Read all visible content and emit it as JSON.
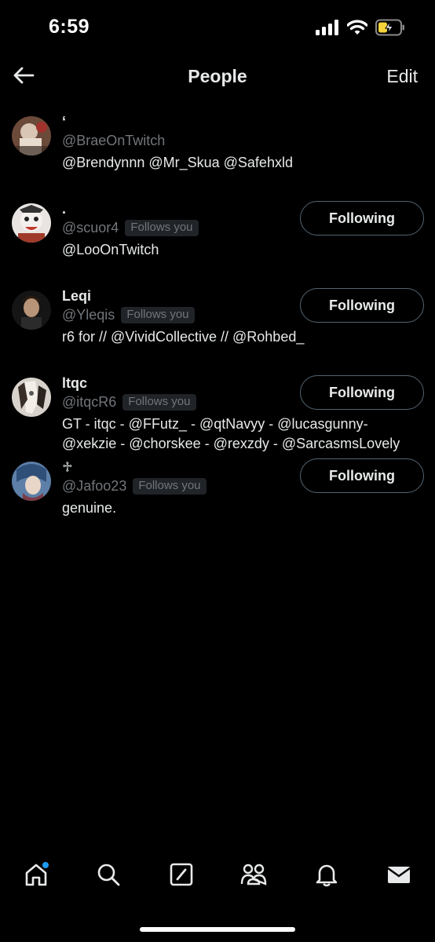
{
  "status_bar": {
    "time": "6:59",
    "icons": [
      "cellular-signal-icon",
      "wifi-icon",
      "battery-charging-icon"
    ],
    "battery_color": "#f5d33b"
  },
  "header": {
    "title": "People",
    "edit_label": "Edit",
    "back_icon": "back-arrow-icon"
  },
  "people": [
    {
      "display_name": "‘",
      "handle": "@BraeOnTwitch",
      "follows_you": false,
      "bio": [
        "@Brendynnn @Mr_Skua @Safehxld"
      ],
      "button_label": ""
    },
    {
      "display_name": ".",
      "handle": "@scuor4",
      "follows_you": true,
      "bio": [
        "@LooOnTwitch"
      ],
      "button_label": "Following"
    },
    {
      "display_name": "Leqi",
      "handle": "@Yleqis",
      "follows_you": true,
      "bio": [
        "r6 for // @VividCollective // @Rohbed_"
      ],
      "button_label": "Following"
    },
    {
      "display_name": "ltqc",
      "handle": "@itqcR6",
      "follows_you": true,
      "bio": [
        "GT - itqc - @FFutz_ - @qtNavyy - @lucasgunny-",
        "@xekzie - @chorskee - @rexzdy - @SarcasmsLovely"
      ],
      "button_label": "Following"
    },
    {
      "display_name": "♱",
      "handle": "@Jafoo23",
      "follows_you": true,
      "bio": [
        "genuine."
      ],
      "button_label": "Following"
    }
  ],
  "follows_you_label": "Follows you",
  "tab_bar": {
    "tabs": [
      "home-icon",
      "search-icon",
      "compose-icon",
      "communities-icon",
      "notifications-icon",
      "messages-icon"
    ],
    "active": "home-icon",
    "notification_dot_color": "#1d9bf0"
  }
}
